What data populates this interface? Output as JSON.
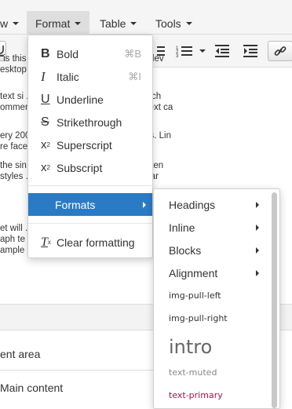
{
  "menubar": {
    "view_label": "w",
    "format_label": "Format",
    "table_label": "Table",
    "tools_label": "Tools"
  },
  "editor_lines": [
    {
      "text": "\"is this ... titles should not be cryptic, clev"
    },
    {
      "text": "esktop ... o look too noisy."
    },
    {
      "text": "text si ... ray instead of black. While tech"
    },
    {
      "text": "ommen ... of one to three lines. This text ca"
    },
    {
      "text": "ery 200 ... eaders or paragraph breaks. Lin"
    },
    {
      "text": "re face ... w."
    },
    {
      "text": "the sin ... and italic. The best web conten"
    },
    {
      "text": "styles ... especially when our readers ar"
    },
    {
      "text": "et will ... sty"
    },
    {
      "text": "aph te ... le s"
    },
    {
      "text": "ample"
    }
  ],
  "lower_panel": {
    "row1": "ent area",
    "row2": "Main content"
  },
  "format_menu": {
    "items": [
      {
        "label": "Bold",
        "shortcut": "⌘B",
        "icon": "bold-icon"
      },
      {
        "label": "Italic",
        "shortcut": "⌘I",
        "icon": "italic-icon"
      },
      {
        "label": "Underline",
        "icon": "underline-icon"
      },
      {
        "label": "Strikethrough",
        "icon": "strikethrough-icon"
      },
      {
        "label": "Superscript",
        "icon": "superscript-icon"
      },
      {
        "label": "Subscript",
        "icon": "subscript-icon"
      }
    ],
    "formats_label": "Formats",
    "clear_label": "Clear formatting",
    "active_color": "#2a7bc6"
  },
  "formats_submenu": {
    "items": [
      {
        "label": "Headings",
        "has_children": true
      },
      {
        "label": "Inline",
        "has_children": true
      },
      {
        "label": "Blocks",
        "has_children": true
      },
      {
        "label": "Alignment",
        "has_children": true
      },
      {
        "label": "img-pull-left",
        "has_children": false
      },
      {
        "label": "img-pull-right",
        "has_children": false
      },
      {
        "label": "intro",
        "has_children": false
      },
      {
        "label": "text-muted",
        "has_children": false,
        "color": "#888888"
      },
      {
        "label": "text-primary",
        "has_children": false,
        "color": "#a0174a"
      }
    ]
  }
}
